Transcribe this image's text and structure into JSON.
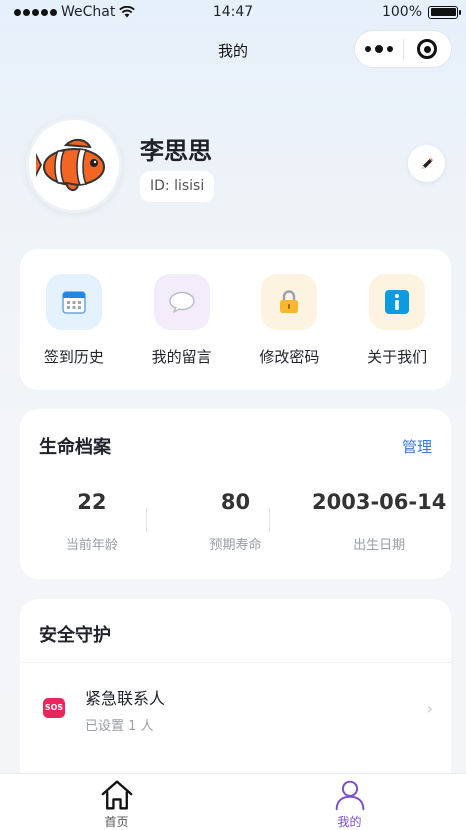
{
  "status_bar": {
    "carrier": "WeChat",
    "time": "14:47",
    "battery": "100%",
    "battery_level": 1.0
  },
  "nav": {
    "title": "我的"
  },
  "profile": {
    "name": "李思思",
    "id_text": "ID: lisisi",
    "avatar_icon": "clownfish-avatar",
    "edit_icon": "pencil-icon"
  },
  "quick_actions": [
    {
      "label": "签到历史",
      "icon": "calendar-icon",
      "bg": "#e3f2fd"
    },
    {
      "label": "我的留言",
      "icon": "chat-bubble-icon",
      "bg": "#f3ecfb"
    },
    {
      "label": "修改密码",
      "icon": "lock-icon",
      "bg": "#fdf3e1"
    },
    {
      "label": "关于我们",
      "icon": "info-icon",
      "bg": "#fdf3e1"
    }
  ],
  "life_archive": {
    "title": "生命档案",
    "manage_label": "管理",
    "stats": [
      {
        "value": "22",
        "label": "当前年龄"
      },
      {
        "value": "80",
        "label": "预期寿命"
      },
      {
        "value": "2003-06-14",
        "label": "出生日期"
      }
    ]
  },
  "safety": {
    "title": "安全守护",
    "emergency_contact": {
      "badge": "SOS",
      "title": "紧急联系人",
      "subtitle": "已设置 1 人"
    }
  },
  "tabbar": {
    "items": [
      {
        "label": "首页",
        "icon": "home-icon"
      },
      {
        "label": "我的",
        "icon": "user-icon"
      }
    ]
  },
  "colors": {
    "accent": "#3a7bd5",
    "tab_active": "#7a4ec7",
    "sos": "#e8275d"
  }
}
